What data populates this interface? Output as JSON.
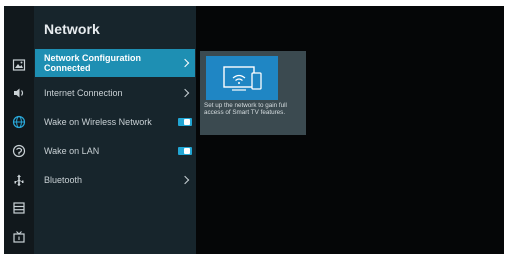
{
  "panel": {
    "title": "Network"
  },
  "menu": [
    {
      "label": "Network Configuration",
      "sublabel": "Connected",
      "control": "chevron"
    },
    {
      "label": "Internet Connection",
      "control": "chevron"
    },
    {
      "label": "Wake on Wireless Network",
      "control": "toggle",
      "value": "on"
    },
    {
      "label": "Wake on LAN",
      "control": "toggle",
      "value": "on"
    },
    {
      "label": "Bluetooth",
      "control": "chevron"
    }
  ],
  "sidebar_icons": [
    "picture-icon",
    "sound-icon",
    "network-icon",
    "accessibility-icon",
    "connection-icon",
    "menu-list-icon",
    "tv-icon"
  ],
  "preview": {
    "image_icon": "wifi-network-icon",
    "description": "Set up the network to gain full access of Smart TV features."
  },
  "colors": {
    "accent": "#1e8fb3",
    "panel_bg": "#17252c",
    "toggle_on": "#22a6d4"
  }
}
